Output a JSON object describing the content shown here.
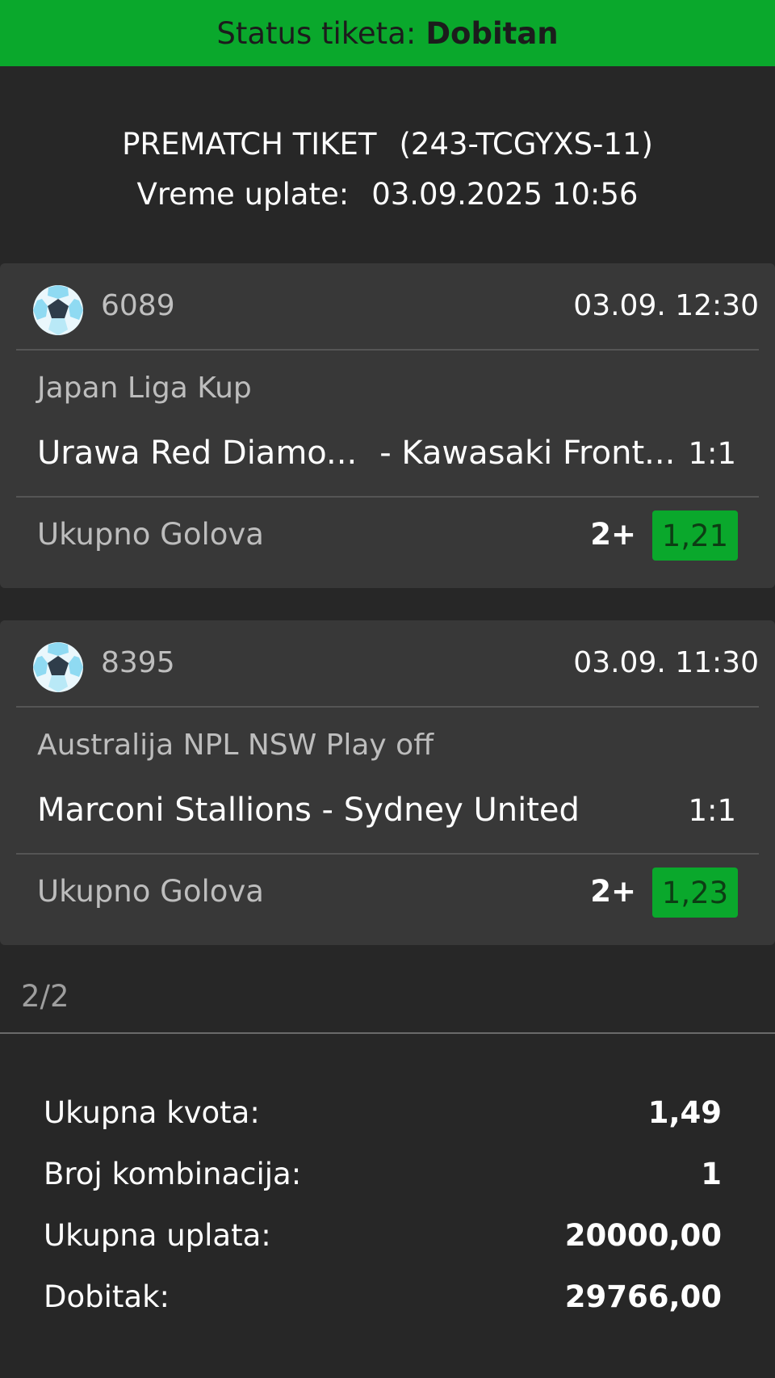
{
  "status": {
    "label": "Status tiketa:",
    "value": "Dobitan",
    "color": "#0aa82c"
  },
  "ticket": {
    "type": "PREMATCH TIKET",
    "id": "(243-TCGYXS-11)",
    "time_label": "Vreme uplate:",
    "time_value": "03.09.2025 10:56"
  },
  "events": [
    {
      "icon": "soccer-ball-icon",
      "code": "6089",
      "datetime": "03.09.  12:30",
      "league": "Japan Liga Kup",
      "home": "Urawa Red Diamo...",
      "away": "- Kawasaki Front...",
      "score": "1:1",
      "market": "Ukupno Golova",
      "pick": "2+",
      "odd": "1,21"
    },
    {
      "icon": "soccer-ball-icon",
      "code": "8395",
      "datetime": "03.09.  11:30",
      "league": "Australija NPL NSW Play off",
      "home": "Marconi Stallions",
      "away": "- Sydney United",
      "score": "1:1",
      "market": "Ukupno Golova",
      "pick": "2+",
      "odd": "1,23"
    }
  ],
  "pager": "2/2",
  "summary": [
    {
      "label": "Ukupna kvota:",
      "value": "1,49"
    },
    {
      "label": "Broj kombinacija:",
      "value": "1"
    },
    {
      "label": "Ukupna uplata:",
      "value": "20000,00"
    },
    {
      "label": "Dobitak:",
      "value": "29766,00"
    }
  ]
}
